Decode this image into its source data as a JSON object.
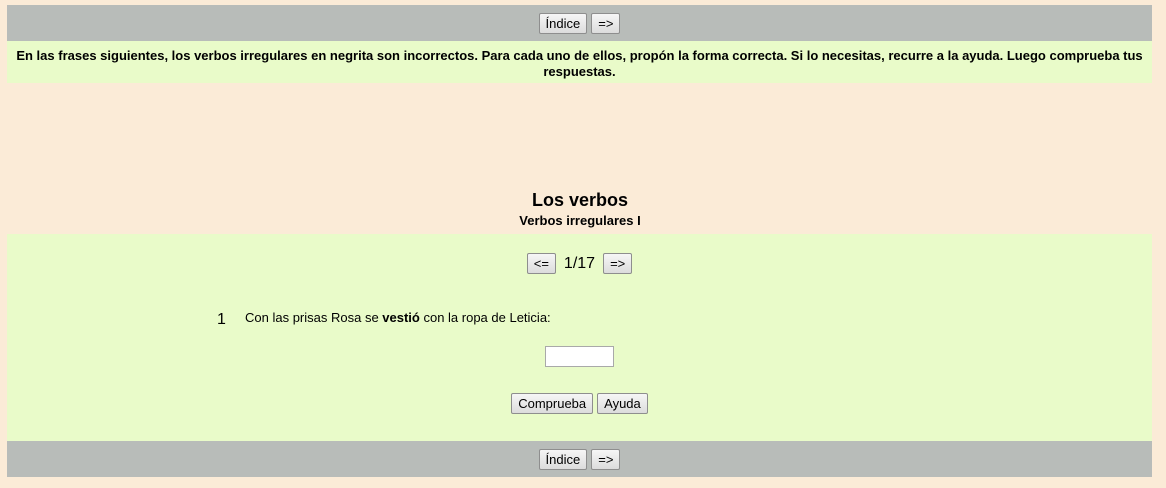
{
  "nav": {
    "index_label": "Índice",
    "next_label": "=>"
  },
  "instructions": "En las frases siguientes, los verbos irregulares en negrita son incorrectos. Para cada uno de ellos, propón la forma correcta. Si lo necesitas, recurre a la ayuda. Luego comprueba tus respuestas.",
  "title": "Los verbos",
  "subtitle": "Verbos irregulares I",
  "pager": {
    "prev_label": "<=",
    "indicator": "1/17",
    "next_label": "=>"
  },
  "question": {
    "number": "1",
    "text_before": "Con las prisas Rosa se ",
    "verb": "vestió",
    "text_after": " con la ropa de Leticia:",
    "answer_value": ""
  },
  "actions": {
    "check_label": "Comprueba",
    "help_label": "Ayuda"
  },
  "colors": {
    "background": "#fbebd7",
    "nav_bar": "#b8bcb9",
    "panel": "#e9fbc9"
  }
}
